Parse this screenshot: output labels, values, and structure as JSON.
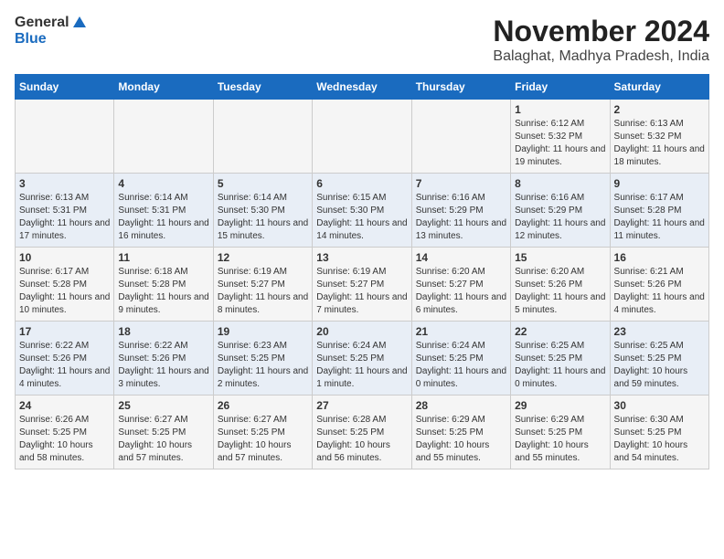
{
  "header": {
    "logo_general": "General",
    "logo_blue": "Blue",
    "month_title": "November 2024",
    "subtitle": "Balaghat, Madhya Pradesh, India"
  },
  "weekdays": [
    "Sunday",
    "Monday",
    "Tuesday",
    "Wednesday",
    "Thursday",
    "Friday",
    "Saturday"
  ],
  "rows": [
    [
      {
        "day": "",
        "text": ""
      },
      {
        "day": "",
        "text": ""
      },
      {
        "day": "",
        "text": ""
      },
      {
        "day": "",
        "text": ""
      },
      {
        "day": "",
        "text": ""
      },
      {
        "day": "1",
        "text": "Sunrise: 6:12 AM\nSunset: 5:32 PM\nDaylight: 11 hours and 19 minutes."
      },
      {
        "day": "2",
        "text": "Sunrise: 6:13 AM\nSunset: 5:32 PM\nDaylight: 11 hours and 18 minutes."
      }
    ],
    [
      {
        "day": "3",
        "text": "Sunrise: 6:13 AM\nSunset: 5:31 PM\nDaylight: 11 hours and 17 minutes."
      },
      {
        "day": "4",
        "text": "Sunrise: 6:14 AM\nSunset: 5:31 PM\nDaylight: 11 hours and 16 minutes."
      },
      {
        "day": "5",
        "text": "Sunrise: 6:14 AM\nSunset: 5:30 PM\nDaylight: 11 hours and 15 minutes."
      },
      {
        "day": "6",
        "text": "Sunrise: 6:15 AM\nSunset: 5:30 PM\nDaylight: 11 hours and 14 minutes."
      },
      {
        "day": "7",
        "text": "Sunrise: 6:16 AM\nSunset: 5:29 PM\nDaylight: 11 hours and 13 minutes."
      },
      {
        "day": "8",
        "text": "Sunrise: 6:16 AM\nSunset: 5:29 PM\nDaylight: 11 hours and 12 minutes."
      },
      {
        "day": "9",
        "text": "Sunrise: 6:17 AM\nSunset: 5:28 PM\nDaylight: 11 hours and 11 minutes."
      }
    ],
    [
      {
        "day": "10",
        "text": "Sunrise: 6:17 AM\nSunset: 5:28 PM\nDaylight: 11 hours and 10 minutes."
      },
      {
        "day": "11",
        "text": "Sunrise: 6:18 AM\nSunset: 5:28 PM\nDaylight: 11 hours and 9 minutes."
      },
      {
        "day": "12",
        "text": "Sunrise: 6:19 AM\nSunset: 5:27 PM\nDaylight: 11 hours and 8 minutes."
      },
      {
        "day": "13",
        "text": "Sunrise: 6:19 AM\nSunset: 5:27 PM\nDaylight: 11 hours and 7 minutes."
      },
      {
        "day": "14",
        "text": "Sunrise: 6:20 AM\nSunset: 5:27 PM\nDaylight: 11 hours and 6 minutes."
      },
      {
        "day": "15",
        "text": "Sunrise: 6:20 AM\nSunset: 5:26 PM\nDaylight: 11 hours and 5 minutes."
      },
      {
        "day": "16",
        "text": "Sunrise: 6:21 AM\nSunset: 5:26 PM\nDaylight: 11 hours and 4 minutes."
      }
    ],
    [
      {
        "day": "17",
        "text": "Sunrise: 6:22 AM\nSunset: 5:26 PM\nDaylight: 11 hours and 4 minutes."
      },
      {
        "day": "18",
        "text": "Sunrise: 6:22 AM\nSunset: 5:26 PM\nDaylight: 11 hours and 3 minutes."
      },
      {
        "day": "19",
        "text": "Sunrise: 6:23 AM\nSunset: 5:25 PM\nDaylight: 11 hours and 2 minutes."
      },
      {
        "day": "20",
        "text": "Sunrise: 6:24 AM\nSunset: 5:25 PM\nDaylight: 11 hours and 1 minute."
      },
      {
        "day": "21",
        "text": "Sunrise: 6:24 AM\nSunset: 5:25 PM\nDaylight: 11 hours and 0 minutes."
      },
      {
        "day": "22",
        "text": "Sunrise: 6:25 AM\nSunset: 5:25 PM\nDaylight: 11 hours and 0 minutes."
      },
      {
        "day": "23",
        "text": "Sunrise: 6:25 AM\nSunset: 5:25 PM\nDaylight: 10 hours and 59 minutes."
      }
    ],
    [
      {
        "day": "24",
        "text": "Sunrise: 6:26 AM\nSunset: 5:25 PM\nDaylight: 10 hours and 58 minutes."
      },
      {
        "day": "25",
        "text": "Sunrise: 6:27 AM\nSunset: 5:25 PM\nDaylight: 10 hours and 57 minutes."
      },
      {
        "day": "26",
        "text": "Sunrise: 6:27 AM\nSunset: 5:25 PM\nDaylight: 10 hours and 57 minutes."
      },
      {
        "day": "27",
        "text": "Sunrise: 6:28 AM\nSunset: 5:25 PM\nDaylight: 10 hours and 56 minutes."
      },
      {
        "day": "28",
        "text": "Sunrise: 6:29 AM\nSunset: 5:25 PM\nDaylight: 10 hours and 55 minutes."
      },
      {
        "day": "29",
        "text": "Sunrise: 6:29 AM\nSunset: 5:25 PM\nDaylight: 10 hours and 55 minutes."
      },
      {
        "day": "30",
        "text": "Sunrise: 6:30 AM\nSunset: 5:25 PM\nDaylight: 10 hours and 54 minutes."
      }
    ]
  ]
}
